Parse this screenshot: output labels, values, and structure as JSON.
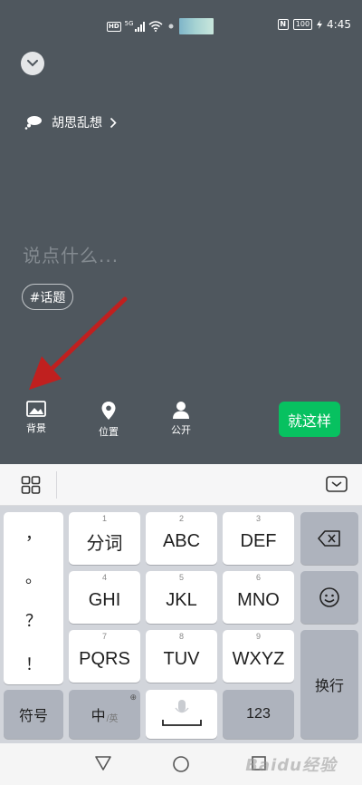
{
  "status_bar": {
    "hd": "HD",
    "network": "5G",
    "battery": "100",
    "time": "4:45"
  },
  "editor": {
    "topic_label": "胡思乱想",
    "placeholder": "说点什么...",
    "hashtag_label": "#话题",
    "toolbar": {
      "background_label": "背景",
      "location_label": "位置",
      "visibility_label": "公开"
    },
    "submit_label": "就这样",
    "accent_color": "#07c160",
    "annotation_arrow_color": "#c0201f"
  },
  "keyboard": {
    "punctuation": [
      "，",
      "。",
      "？",
      "！"
    ],
    "keys": [
      {
        "num": "1",
        "label": "分词"
      },
      {
        "num": "2",
        "label": "ABC"
      },
      {
        "num": "3",
        "label": "DEF"
      },
      {
        "num": "4",
        "label": "GHI"
      },
      {
        "num": "5",
        "label": "JKL"
      },
      {
        "num": "6",
        "label": "MNO"
      },
      {
        "num": "7",
        "label": "PQRS"
      },
      {
        "num": "8",
        "label": "TUV"
      },
      {
        "num": "9",
        "label": "WXYZ"
      }
    ],
    "symbols_label": "符号",
    "lang_label": "中",
    "lang_sub": "/英",
    "numbers_label": "123",
    "enter_label": "换行"
  },
  "navbar": {
    "watermark": "Baidu经验"
  }
}
